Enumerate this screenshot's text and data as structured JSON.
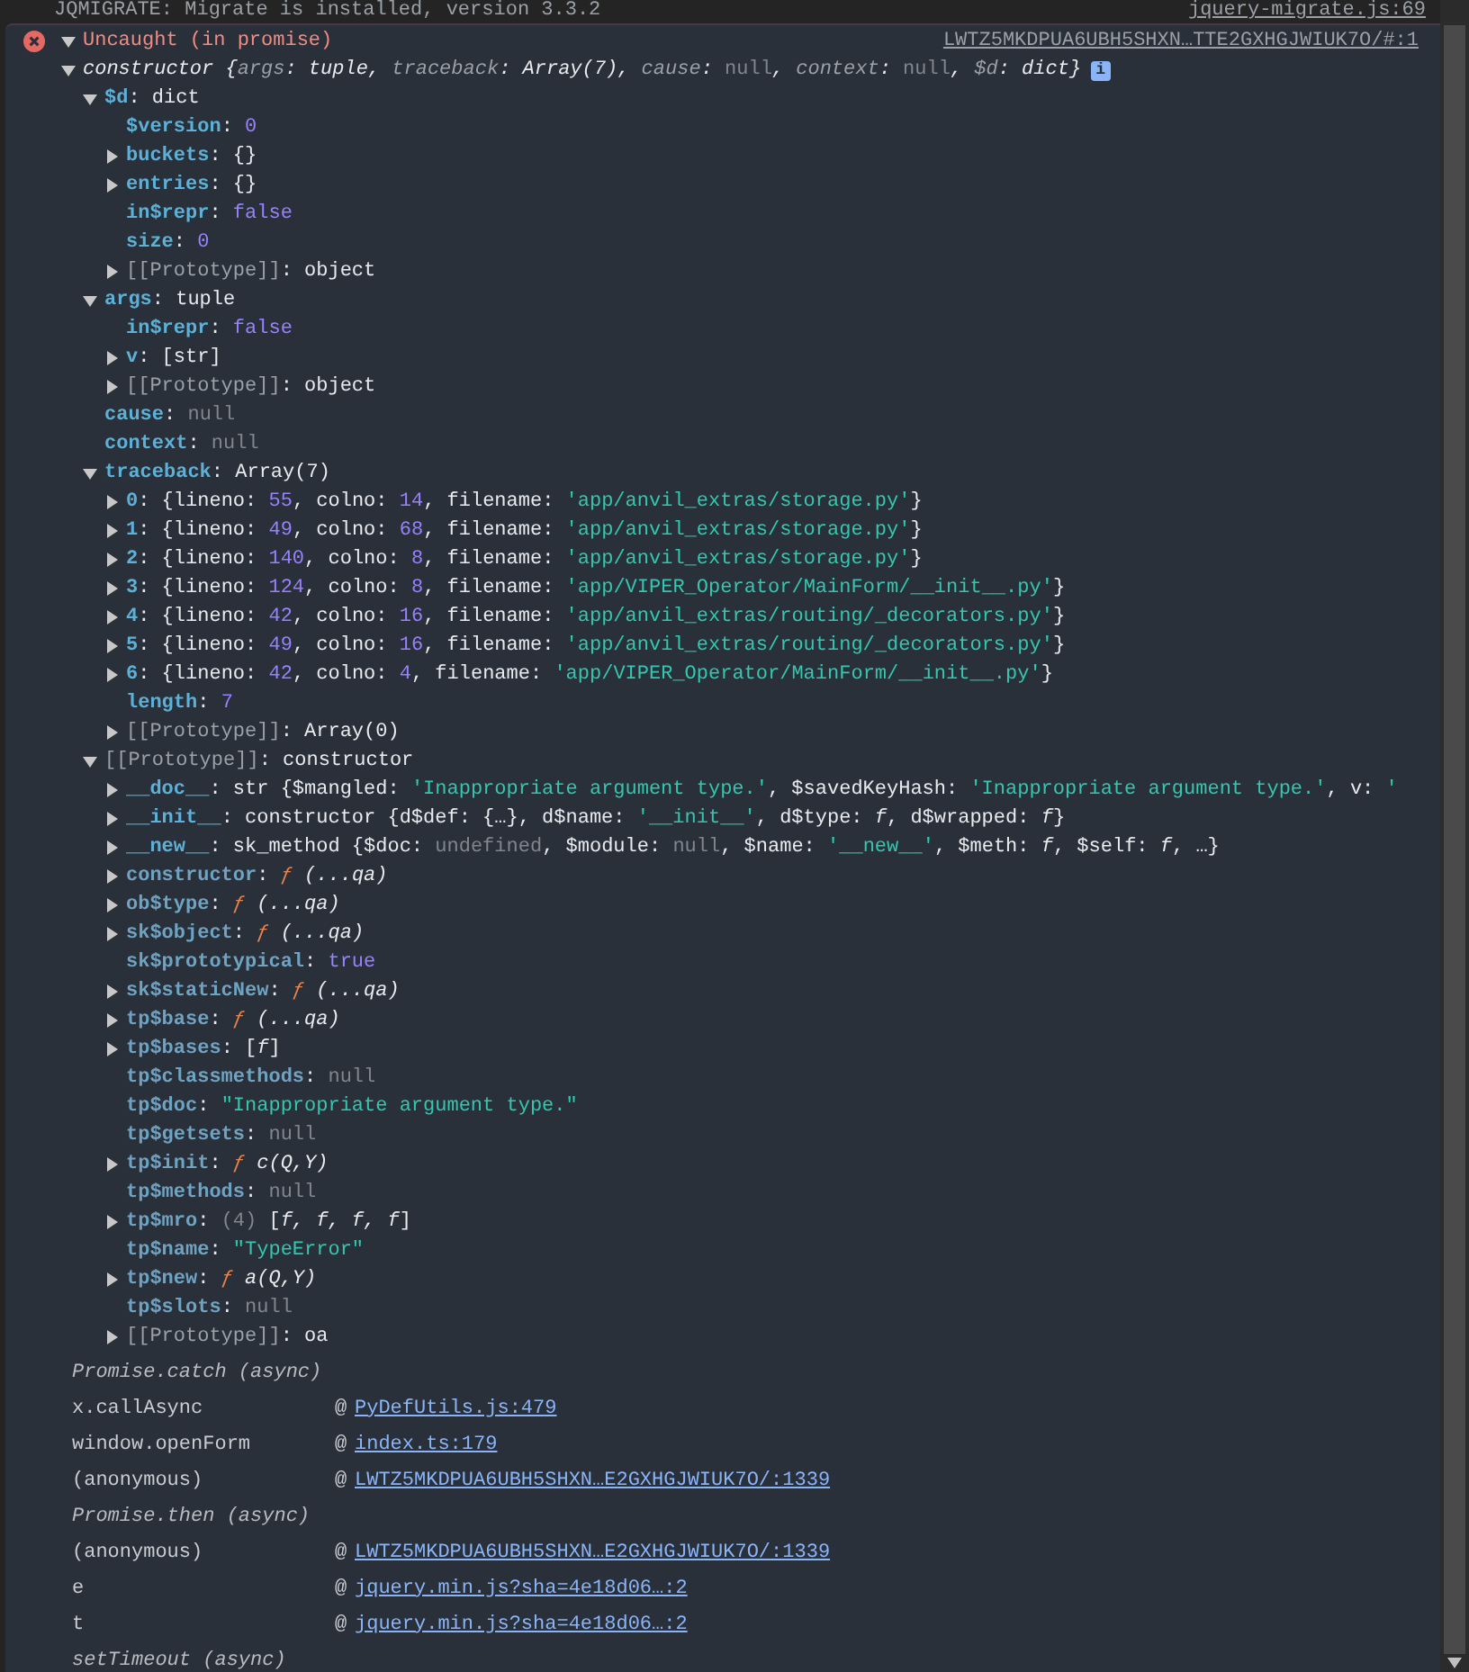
{
  "previous_message": {
    "text": "JQMIGRATE: Migrate is installed, version 3.3.2",
    "source": "jquery-migrate.js:69"
  },
  "error": {
    "title": "Uncaught (in promise)",
    "source": "LWTZ5MKDPUA6UBH5SHXN…TTE2GXHGJWIUK7O/#:1",
    "expanded": true
  },
  "object_tree": {
    "kind": "expandable",
    "expanded": true,
    "badge": "i",
    "parts": [
      {
        "text": "constructor",
        "kind": "italic"
      },
      {
        "text": " {",
        "kind": "italic"
      },
      {
        "text": "args",
        "kind": "preview_key"
      },
      {
        "text": ": tuple, ",
        "kind": "italic"
      },
      {
        "text": "traceback",
        "kind": "preview_key"
      },
      {
        "text": ": Array(7), ",
        "kind": "italic"
      },
      {
        "text": "cause",
        "kind": "preview_key"
      },
      {
        "text": ": ",
        "kind": "italic"
      },
      {
        "text": "null",
        "kind": "null"
      },
      {
        "text": ", ",
        "kind": "italic"
      },
      {
        "text": "context",
        "kind": "preview_key"
      },
      {
        "text": ": ",
        "kind": "italic"
      },
      {
        "text": "null",
        "kind": "null"
      },
      {
        "text": ", ",
        "kind": "italic"
      },
      {
        "text": "$d",
        "kind": "preview_key"
      },
      {
        "text": ": dict}",
        "kind": "italic"
      }
    ],
    "children": [
      {
        "kind": "expandable",
        "expanded": true,
        "parts": [
          {
            "text": "$d",
            "kind": "key"
          },
          {
            "text": ": dict",
            "kind": "text"
          }
        ],
        "children": [
          {
            "kind": "leaf",
            "parts": [
              {
                "text": "$version",
                "kind": "key"
              },
              {
                "text": ": ",
                "kind": "text"
              },
              {
                "text": "0",
                "kind": "number"
              }
            ]
          },
          {
            "kind": "expandable",
            "expanded": false,
            "parts": [
              {
                "text": "buckets",
                "kind": "key"
              },
              {
                "text": ": {}",
                "kind": "text"
              }
            ]
          },
          {
            "kind": "expandable",
            "expanded": false,
            "parts": [
              {
                "text": "entries",
                "kind": "key"
              },
              {
                "text": ": {}",
                "kind": "text"
              }
            ]
          },
          {
            "kind": "leaf",
            "parts": [
              {
                "text": "in$repr",
                "kind": "key"
              },
              {
                "text": ": ",
                "kind": "text"
              },
              {
                "text": "false",
                "kind": "boolean"
              }
            ]
          },
          {
            "kind": "leaf",
            "parts": [
              {
                "text": "size",
                "kind": "key"
              },
              {
                "text": ": ",
                "kind": "text"
              },
              {
                "text": "0",
                "kind": "number"
              }
            ]
          },
          {
            "kind": "expandable",
            "expanded": false,
            "parts": [
              {
                "text": "[[Prototype]]",
                "kind": "internal"
              },
              {
                "text": ": object",
                "kind": "text"
              }
            ]
          }
        ]
      },
      {
        "kind": "expandable",
        "expanded": true,
        "parts": [
          {
            "text": "args",
            "kind": "key"
          },
          {
            "text": ": tuple",
            "kind": "text"
          }
        ],
        "children": [
          {
            "kind": "leaf",
            "parts": [
              {
                "text": "in$repr",
                "kind": "key"
              },
              {
                "text": ": ",
                "kind": "text"
              },
              {
                "text": "false",
                "kind": "boolean"
              }
            ]
          },
          {
            "kind": "expandable",
            "expanded": false,
            "parts": [
              {
                "text": "v",
                "kind": "key"
              },
              {
                "text": ": [str]",
                "kind": "text"
              }
            ]
          },
          {
            "kind": "expandable",
            "expanded": false,
            "parts": [
              {
                "text": "[[Prototype]]",
                "kind": "internal"
              },
              {
                "text": ": object",
                "kind": "text"
              }
            ]
          }
        ]
      },
      {
        "kind": "leaf",
        "parts": [
          {
            "text": "cause",
            "kind": "key"
          },
          {
            "text": ": ",
            "kind": "text"
          },
          {
            "text": "null",
            "kind": "null"
          }
        ]
      },
      {
        "kind": "leaf",
        "parts": [
          {
            "text": "context",
            "kind": "key"
          },
          {
            "text": ": ",
            "kind": "text"
          },
          {
            "text": "null",
            "kind": "null"
          }
        ]
      },
      {
        "kind": "expandable",
        "expanded": true,
        "parts": [
          {
            "text": "traceback",
            "kind": "key"
          },
          {
            "text": ": Array(7)",
            "kind": "text"
          }
        ],
        "children": [
          {
            "kind": "expandable",
            "expanded": false,
            "parts": [
              {
                "text": "0",
                "kind": "key"
              },
              {
                "text": ": {lineno: ",
                "kind": "text"
              },
              {
                "text": "55",
                "kind": "number"
              },
              {
                "text": ", colno: ",
                "kind": "text"
              },
              {
                "text": "14",
                "kind": "number"
              },
              {
                "text": ", filename: ",
                "kind": "text"
              },
              {
                "text": "'app/anvil_extras/storage.py'",
                "kind": "string"
              },
              {
                "text": "}",
                "kind": "text"
              }
            ]
          },
          {
            "kind": "expandable",
            "expanded": false,
            "parts": [
              {
                "text": "1",
                "kind": "key"
              },
              {
                "text": ": {lineno: ",
                "kind": "text"
              },
              {
                "text": "49",
                "kind": "number"
              },
              {
                "text": ", colno: ",
                "kind": "text"
              },
              {
                "text": "68",
                "kind": "number"
              },
              {
                "text": ", filename: ",
                "kind": "text"
              },
              {
                "text": "'app/anvil_extras/storage.py'",
                "kind": "string"
              },
              {
                "text": "}",
                "kind": "text"
              }
            ]
          },
          {
            "kind": "expandable",
            "expanded": false,
            "parts": [
              {
                "text": "2",
                "kind": "key"
              },
              {
                "text": ": {lineno: ",
                "kind": "text"
              },
              {
                "text": "140",
                "kind": "number"
              },
              {
                "text": ", colno: ",
                "kind": "text"
              },
              {
                "text": "8",
                "kind": "number"
              },
              {
                "text": ", filename: ",
                "kind": "text"
              },
              {
                "text": "'app/anvil_extras/storage.py'",
                "kind": "string"
              },
              {
                "text": "}",
                "kind": "text"
              }
            ]
          },
          {
            "kind": "expandable",
            "expanded": false,
            "parts": [
              {
                "text": "3",
                "kind": "key"
              },
              {
                "text": ": {lineno: ",
                "kind": "text"
              },
              {
                "text": "124",
                "kind": "number"
              },
              {
                "text": ", colno: ",
                "kind": "text"
              },
              {
                "text": "8",
                "kind": "number"
              },
              {
                "text": ", filename: ",
                "kind": "text"
              },
              {
                "text": "'app/VIPER_Operator/MainForm/__init__.py'",
                "kind": "string"
              },
              {
                "text": "}",
                "kind": "text"
              }
            ]
          },
          {
            "kind": "expandable",
            "expanded": false,
            "parts": [
              {
                "text": "4",
                "kind": "key"
              },
              {
                "text": ": {lineno: ",
                "kind": "text"
              },
              {
                "text": "42",
                "kind": "number"
              },
              {
                "text": ", colno: ",
                "kind": "text"
              },
              {
                "text": "16",
                "kind": "number"
              },
              {
                "text": ", filename: ",
                "kind": "text"
              },
              {
                "text": "'app/anvil_extras/routing/_decorators.py'",
                "kind": "string"
              },
              {
                "text": "}",
                "kind": "text"
              }
            ]
          },
          {
            "kind": "expandable",
            "expanded": false,
            "parts": [
              {
                "text": "5",
                "kind": "key"
              },
              {
                "text": ": {lineno: ",
                "kind": "text"
              },
              {
                "text": "49",
                "kind": "number"
              },
              {
                "text": ", colno: ",
                "kind": "text"
              },
              {
                "text": "16",
                "kind": "number"
              },
              {
                "text": ", filename: ",
                "kind": "text"
              },
              {
                "text": "'app/anvil_extras/routing/_decorators.py'",
                "kind": "string"
              },
              {
                "text": "}",
                "kind": "text"
              }
            ]
          },
          {
            "kind": "expandable",
            "expanded": false,
            "parts": [
              {
                "text": "6",
                "kind": "key"
              },
              {
                "text": ": {lineno: ",
                "kind": "text"
              },
              {
                "text": "42",
                "kind": "number"
              },
              {
                "text": ", colno: ",
                "kind": "text"
              },
              {
                "text": "4",
                "kind": "number"
              },
              {
                "text": ", filename: ",
                "kind": "text"
              },
              {
                "text": "'app/VIPER_Operator/MainForm/__init__.py'",
                "kind": "string"
              },
              {
                "text": "}",
                "kind": "text"
              }
            ]
          },
          {
            "kind": "leaf",
            "parts": [
              {
                "text": "length",
                "kind": "key"
              },
              {
                "text": ": ",
                "kind": "text"
              },
              {
                "text": "7",
                "kind": "number"
              }
            ]
          },
          {
            "kind": "expandable",
            "expanded": false,
            "parts": [
              {
                "text": "[[Prototype]]",
                "kind": "internal"
              },
              {
                "text": ": Array(0)",
                "kind": "text"
              }
            ]
          }
        ]
      },
      {
        "kind": "expandable",
        "expanded": true,
        "parts": [
          {
            "text": "[[Prototype]]",
            "kind": "internal"
          },
          {
            "text": ": constructor",
            "kind": "text"
          }
        ],
        "children": [
          {
            "kind": "expandable",
            "expanded": false,
            "parts": [
              {
                "text": "__doc__",
                "kind": "key"
              },
              {
                "text": ": str {$mangled: ",
                "kind": "text"
              },
              {
                "text": "'Inappropriate argument type.'",
                "kind": "string"
              },
              {
                "text": ", $savedKeyHash: ",
                "kind": "text"
              },
              {
                "text": "'Inappropriate argument type.'",
                "kind": "string"
              },
              {
                "text": ", v: ",
                "kind": "text"
              },
              {
                "text": "'",
                "kind": "string"
              }
            ]
          },
          {
            "kind": "expandable",
            "expanded": false,
            "parts": [
              {
                "text": "__init__",
                "kind": "key"
              },
              {
                "text": ": constructor {d$def: {…}, d$name: ",
                "kind": "text"
              },
              {
                "text": "'__init__'",
                "kind": "string"
              },
              {
                "text": ", d$type: ",
                "kind": "text"
              },
              {
                "text": "f",
                "kind": "italic"
              },
              {
                "text": ", d$wrapped: ",
                "kind": "text"
              },
              {
                "text": "f",
                "kind": "italic"
              },
              {
                "text": "}",
                "kind": "text"
              }
            ]
          },
          {
            "kind": "expandable",
            "expanded": false,
            "parts": [
              {
                "text": "__new__",
                "kind": "key"
              },
              {
                "text": ": sk_method {$doc: ",
                "kind": "text"
              },
              {
                "text": "undefined",
                "kind": "null"
              },
              {
                "text": ", $module: ",
                "kind": "text"
              },
              {
                "text": "null",
                "kind": "null"
              },
              {
                "text": ", $name: ",
                "kind": "text"
              },
              {
                "text": "'__new__'",
                "kind": "string"
              },
              {
                "text": ", $meth: ",
                "kind": "text"
              },
              {
                "text": "f",
                "kind": "italic"
              },
              {
                "text": ", $self: ",
                "kind": "text"
              },
              {
                "text": "f",
                "kind": "italic"
              },
              {
                "text": ", …}",
                "kind": "text"
              }
            ]
          },
          {
            "kind": "expandable",
            "expanded": false,
            "parts": [
              {
                "text": "constructor",
                "kind": "inherited_key"
              },
              {
                "text": ": ",
                "kind": "text"
              },
              {
                "text": "ƒ",
                "kind": "function"
              },
              {
                "text": " (...qa)",
                "kind": "italic"
              }
            ]
          },
          {
            "kind": "expandable",
            "expanded": false,
            "parts": [
              {
                "text": "ob$type",
                "kind": "inherited_key"
              },
              {
                "text": ": ",
                "kind": "text"
              },
              {
                "text": "ƒ",
                "kind": "function"
              },
              {
                "text": " (...qa)",
                "kind": "italic"
              }
            ]
          },
          {
            "kind": "expandable",
            "expanded": false,
            "parts": [
              {
                "text": "sk$object",
                "kind": "inherited_key"
              },
              {
                "text": ": ",
                "kind": "text"
              },
              {
                "text": "ƒ",
                "kind": "function"
              },
              {
                "text": " (...qa)",
                "kind": "italic"
              }
            ]
          },
          {
            "kind": "leaf",
            "parts": [
              {
                "text": "sk$prototypical",
                "kind": "inherited_key"
              },
              {
                "text": ": ",
                "kind": "text"
              },
              {
                "text": "true",
                "kind": "boolean"
              }
            ]
          },
          {
            "kind": "expandable",
            "expanded": false,
            "parts": [
              {
                "text": "sk$staticNew",
                "kind": "inherited_key"
              },
              {
                "text": ": ",
                "kind": "text"
              },
              {
                "text": "ƒ",
                "kind": "function"
              },
              {
                "text": " (...qa)",
                "kind": "italic"
              }
            ]
          },
          {
            "kind": "expandable",
            "expanded": false,
            "parts": [
              {
                "text": "tp$base",
                "kind": "inherited_key"
              },
              {
                "text": ": ",
                "kind": "text"
              },
              {
                "text": "ƒ",
                "kind": "function"
              },
              {
                "text": " (...qa)",
                "kind": "italic"
              }
            ]
          },
          {
            "kind": "expandable",
            "expanded": false,
            "parts": [
              {
                "text": "tp$bases",
                "kind": "inherited_key"
              },
              {
                "text": ": [",
                "kind": "text"
              },
              {
                "text": "f",
                "kind": "italic"
              },
              {
                "text": "]",
                "kind": "text"
              }
            ]
          },
          {
            "kind": "leaf",
            "parts": [
              {
                "text": "tp$classmethods",
                "kind": "inherited_key"
              },
              {
                "text": ": ",
                "kind": "text"
              },
              {
                "text": "null",
                "kind": "null"
              }
            ]
          },
          {
            "kind": "leaf",
            "parts": [
              {
                "text": "tp$doc",
                "kind": "inherited_key"
              },
              {
                "text": ": ",
                "kind": "text"
              },
              {
                "text": "\"Inappropriate argument type.\"",
                "kind": "string"
              }
            ]
          },
          {
            "kind": "leaf",
            "parts": [
              {
                "text": "tp$getsets",
                "kind": "inherited_key"
              },
              {
                "text": ": ",
                "kind": "text"
              },
              {
                "text": "null",
                "kind": "null"
              }
            ]
          },
          {
            "kind": "expandable",
            "expanded": false,
            "parts": [
              {
                "text": "tp$init",
                "kind": "inherited_key"
              },
              {
                "text": ": ",
                "kind": "text"
              },
              {
                "text": "ƒ",
                "kind": "function"
              },
              {
                "text": " c(Q,Y)",
                "kind": "italic"
              }
            ]
          },
          {
            "kind": "leaf",
            "parts": [
              {
                "text": "tp$methods",
                "kind": "inherited_key"
              },
              {
                "text": ": ",
                "kind": "text"
              },
              {
                "text": "null",
                "kind": "null"
              }
            ]
          },
          {
            "kind": "expandable",
            "expanded": false,
            "parts": [
              {
                "text": "tp$mro",
                "kind": "inherited_key"
              },
              {
                "text": ": ",
                "kind": "text"
              },
              {
                "text": "(4)",
                "kind": "null"
              },
              {
                "text": " [",
                "kind": "text"
              },
              {
                "text": "f, f, f, f",
                "kind": "italic"
              },
              {
                "text": "]",
                "kind": "text"
              }
            ]
          },
          {
            "kind": "leaf",
            "parts": [
              {
                "text": "tp$name",
                "kind": "inherited_key"
              },
              {
                "text": ": ",
                "kind": "text"
              },
              {
                "text": "\"TypeError\"",
                "kind": "string"
              }
            ]
          },
          {
            "kind": "expandable",
            "expanded": false,
            "parts": [
              {
                "text": "tp$new",
                "kind": "inherited_key"
              },
              {
                "text": ": ",
                "kind": "text"
              },
              {
                "text": "ƒ",
                "kind": "function"
              },
              {
                "text": " a(Q,Y)",
                "kind": "italic"
              }
            ]
          },
          {
            "kind": "leaf",
            "parts": [
              {
                "text": "tp$slots",
                "kind": "inherited_key"
              },
              {
                "text": ": ",
                "kind": "text"
              },
              {
                "text": "null",
                "kind": "null"
              }
            ]
          },
          {
            "kind": "expandable",
            "expanded": false,
            "parts": [
              {
                "text": "[[Prototype]]",
                "kind": "internal"
              },
              {
                "text": ": oa",
                "kind": "text"
              }
            ]
          }
        ]
      }
    ]
  },
  "stack_trace": [
    {
      "kind": "async",
      "label": "Promise.catch (async)"
    },
    {
      "kind": "frame",
      "function": "x.callAsync",
      "at": "@",
      "location": "PyDefUtils.js:479"
    },
    {
      "kind": "frame",
      "function": "window.openForm",
      "at": "@",
      "location": "index.ts:179"
    },
    {
      "kind": "frame",
      "function": "(anonymous)",
      "at": "@",
      "location": "LWTZ5MKDPUA6UBH5SHXN…E2GXHGJWIUK7O/:1339"
    },
    {
      "kind": "async",
      "label": "Promise.then (async)"
    },
    {
      "kind": "frame",
      "function": "(anonymous)",
      "at": "@",
      "location": "LWTZ5MKDPUA6UBH5SHXN…E2GXHGJWIUK7O/:1339"
    },
    {
      "kind": "frame",
      "function": "e",
      "at": "@",
      "location": "jquery.min.js?sha=4e18d06…:2"
    },
    {
      "kind": "frame",
      "function": "t",
      "at": "@",
      "location": "jquery.min.js?sha=4e18d06…:2"
    },
    {
      "kind": "async",
      "label": "setTimeout (async)"
    }
  ]
}
